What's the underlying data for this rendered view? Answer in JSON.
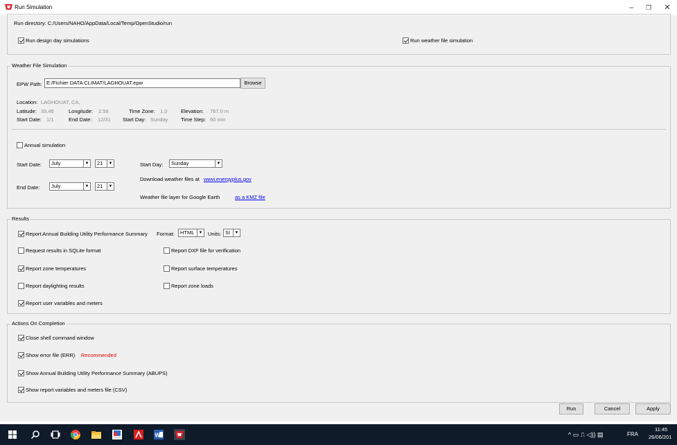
{
  "window": {
    "title": "Run Simulation",
    "minimize": "–",
    "maximize": "❐",
    "close": "✕"
  },
  "run_directory": "Run directory: C:/Users/NAHO/AppData/Local/Temp/OpenStudio/run",
  "top_options": {
    "design_day": {
      "label": "Run design day simulations",
      "checked": true
    },
    "weather_file": {
      "label": "Run weather file simulation",
      "checked": true
    }
  },
  "weather": {
    "group_title": "Weather File Simulation",
    "epw_label": "EPW Path:",
    "epw_value": "E:/Fichier DATA CLIMAT/LAGHOUAT.epw",
    "browse": "Browse",
    "location_label": "Location:",
    "location_value": "LAGHOUAT, CA,",
    "latitude_label": "Latitude:",
    "latitude_value": "33.46",
    "longitude_label": "Longitude:",
    "longitude_value": "2.56",
    "timezone_label": "Time Zone:",
    "timezone_value": "1.0",
    "elevation_label": "Elevation:",
    "elevation_value": "767.0 m",
    "startdate_label": "Start Date:",
    "startdate_value": "1/1",
    "enddate_label": "End Date:",
    "enddate_value": "12/31",
    "startday_label": "Start Day:",
    "startday_value": "Sunday",
    "timestep_label": "Time Step:",
    "timestep_value": "60 min",
    "annual": {
      "label": "Annual simulation",
      "checked": false
    },
    "start_date_label": "Start Date:",
    "start_month": "July",
    "start_day": "21",
    "end_date_label": "End Date:",
    "end_month": "July",
    "end_day": "21",
    "start_day_label": "Start Day:",
    "start_day_select": "Sunday",
    "download_text": "Download weather files at",
    "download_link": "www.energyplus.gov",
    "kmz_text": "Weather file layer for Google Earth",
    "kmz_link": "as a KMZ file"
  },
  "results": {
    "group_title": "Results",
    "abups": {
      "label": "Report Annual Building Utility Performance Summary",
      "checked": true
    },
    "format_label": "Format:",
    "format_value": "HTML",
    "units_label": "Units:",
    "units_value": "SI",
    "sqlite": {
      "label": "Request results in SQLite format",
      "checked": false
    },
    "dxf": {
      "label": "Report DXF file for verification",
      "checked": false
    },
    "zone_temps": {
      "label": "Report zone temperatures",
      "checked": true
    },
    "surface_temps": {
      "label": "Report surface temperatures",
      "checked": false
    },
    "daylighting": {
      "label": "Report daylighting results",
      "checked": false
    },
    "zone_loads": {
      "label": "Report zone loads",
      "checked": false
    },
    "user_vars": {
      "label": "Report user variables and meters",
      "checked": true
    }
  },
  "actions": {
    "group_title": "Actions On Completion",
    "close_shell": {
      "label": "Close shell command window",
      "checked": true
    },
    "show_err": {
      "label": "Show error file (ERR)",
      "checked": true
    },
    "recommended": "Recommended",
    "show_abups": {
      "label": "Show Annual Building Utility Performance Summary (ABUPS)",
      "checked": true
    },
    "show_csv": {
      "label": "Show report variables and meters file (CSV)",
      "checked": true
    }
  },
  "buttons": {
    "run": "Run",
    "cancel": "Cancel",
    "apply": "Apply"
  },
  "taskbar": {
    "language": "FRA",
    "time": "11:45",
    "date": "26/06/201",
    "tray_icons": "^ ▭ ⎍ ◁)) ▤"
  }
}
